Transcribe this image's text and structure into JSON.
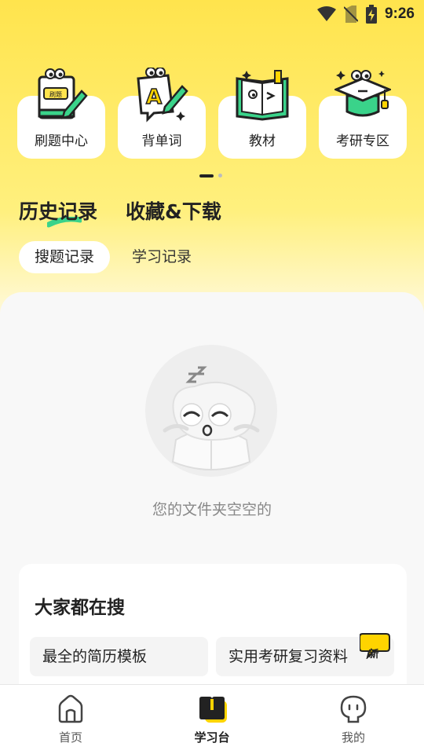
{
  "status_bar": {
    "time": "9:26"
  },
  "features": [
    {
      "label": "刷题中心",
      "icon": "practice-sheet-icon",
      "badge_text": "刷题"
    },
    {
      "label": "背单词",
      "icon": "vocabulary-icon"
    },
    {
      "label": "教材",
      "icon": "textbook-icon"
    },
    {
      "label": "考研专区",
      "icon": "graduation-cap-icon"
    }
  ],
  "main_tabs": [
    {
      "label": "历史记录",
      "active": true
    },
    {
      "label": "收藏&下载",
      "active": false
    }
  ],
  "sub_tabs": [
    {
      "label": "搜题记录",
      "active": true
    },
    {
      "label": "学习记录",
      "active": false
    }
  ],
  "empty_state": {
    "message": "您的文件夹空空的"
  },
  "trending": {
    "title": "大家都在搜",
    "items": [
      {
        "label": "最全的简历模板"
      },
      {
        "label": "实用考研复习资料",
        "badge": "新"
      }
    ]
  },
  "bottom_nav": [
    {
      "label": "首页",
      "icon": "home-icon",
      "active": false
    },
    {
      "label": "学习台",
      "icon": "study-desk-icon",
      "active": true
    },
    {
      "label": "我的",
      "icon": "profile-icon",
      "active": false
    }
  ],
  "colors": {
    "accent_yellow": "#ffe44d",
    "accent_green": "#3ad38a"
  }
}
